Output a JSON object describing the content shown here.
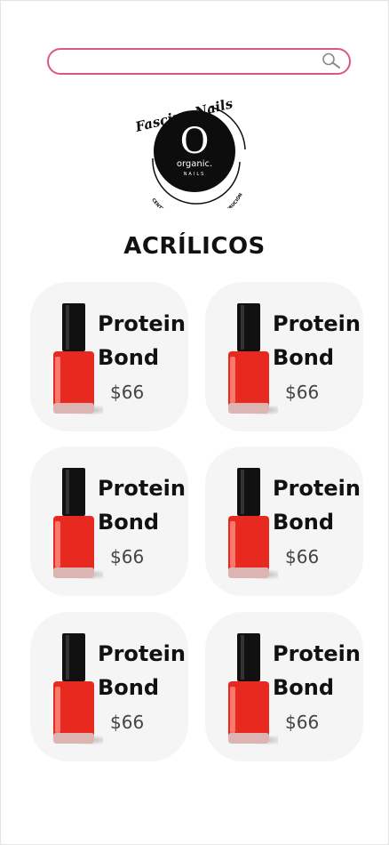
{
  "search": {
    "placeholder": ""
  },
  "logo": {
    "brand_script": "Fascino Nails",
    "emblem_letter": "O",
    "emblem_word": "organic.",
    "emblem_sub": "NAILS",
    "ring_text": "CENTRO DE CAPACITACIÓN Y DISTRIBUCIÓN"
  },
  "page_title": "ACRÍLICOS",
  "products": [
    {
      "name_line1": "Protein",
      "name_line2": "Bond",
      "price": "$66"
    },
    {
      "name_line1": "Protein",
      "name_line2": "Bond",
      "price": "$66"
    },
    {
      "name_line1": "Protein",
      "name_line2": "Bond",
      "price": "$66"
    },
    {
      "name_line1": "Protein",
      "name_line2": "Bond",
      "price": "$66"
    },
    {
      "name_line1": "Protein",
      "name_line2": "Bond",
      "price": "$66"
    },
    {
      "name_line1": "Protein",
      "name_line2": "Bond",
      "price": "$66"
    }
  ],
  "colors": {
    "accent": "#d9578a",
    "polish": "#e8291f",
    "cap": "#111111",
    "card": "#f5f5f5"
  },
  "icons": {
    "search": "search-icon",
    "product_image": "nail-polish-icon"
  }
}
